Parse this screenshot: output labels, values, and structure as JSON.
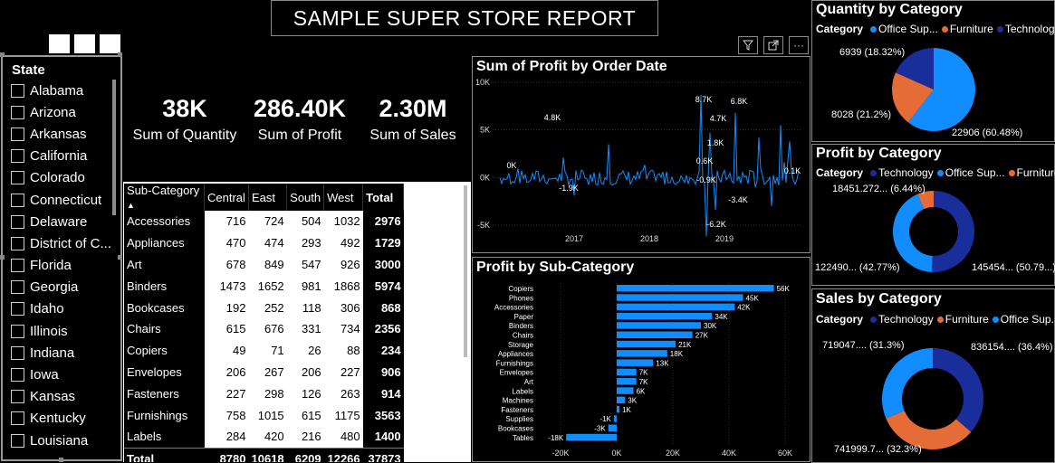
{
  "header": {
    "title": "SAMPLE SUPER STORE REPORT"
  },
  "slicer": {
    "title": "State",
    "items": [
      "Alabama",
      "Arizona",
      "Arkansas",
      "California",
      "Colorado",
      "Connecticut",
      "Delaware",
      "District of C...",
      "Florida",
      "Georgia",
      "Idaho",
      "Illinois",
      "Indiana",
      "Iowa",
      "Kansas",
      "Kentucky",
      "Louisiana"
    ]
  },
  "kpis": [
    {
      "value": "38K",
      "label": "Sum of Quantity"
    },
    {
      "value": "286.40K",
      "label": "Sum of Profit"
    },
    {
      "value": "2.30M",
      "label": "Sum of Sales"
    }
  ],
  "matrix": {
    "columns": [
      "Sub-Category",
      "Central",
      "East",
      "South",
      "West",
      "Total"
    ],
    "sort_indicator": "▲",
    "rows": [
      [
        "Accessories",
        "716",
        "724",
        "504",
        "1032",
        "2976"
      ],
      [
        "Appliances",
        "470",
        "474",
        "293",
        "492",
        "1729"
      ],
      [
        "Art",
        "678",
        "849",
        "547",
        "926",
        "3000"
      ],
      [
        "Binders",
        "1473",
        "1652",
        "981",
        "1868",
        "5974"
      ],
      [
        "Bookcases",
        "192",
        "252",
        "118",
        "306",
        "868"
      ],
      [
        "Chairs",
        "615",
        "676",
        "331",
        "734",
        "2356"
      ],
      [
        "Copiers",
        "49",
        "71",
        "26",
        "88",
        "234"
      ],
      [
        "Envelopes",
        "206",
        "267",
        "206",
        "227",
        "906"
      ],
      [
        "Fasteners",
        "227",
        "298",
        "126",
        "263",
        "914"
      ],
      [
        "Furnishings",
        "758",
        "1015",
        "615",
        "1175",
        "3563"
      ],
      [
        "Labels",
        "284",
        "420",
        "216",
        "480",
        "1400"
      ]
    ],
    "total": [
      "Total",
      "8780",
      "10618",
      "6209",
      "12266",
      "37873"
    ]
  },
  "visual_toolbar": {
    "icons": [
      "filter-icon",
      "focus-mode-icon",
      "more-options-icon"
    ],
    "more_label": "···"
  },
  "profit_by_date": {
    "title": "Sum of Profit by Order Date",
    "y_ticks": [
      "10K",
      "5K",
      "0K",
      "-5K"
    ],
    "x_ticks": [
      "2017",
      "2018",
      "2019"
    ],
    "annotations": [
      "4.8K",
      "-1.9K",
      "0K",
      "8.7K",
      "6.8K",
      "4.7K",
      "1.8K",
      "0.6K",
      "-0.9K",
      "-3.4K",
      "-6.2K",
      "0.1K"
    ]
  },
  "profit_by_subcategory": {
    "title": "Profit by Sub-Category",
    "x_ticks": [
      "-20K",
      "0K",
      "20K",
      "40K",
      "60K"
    ],
    "bars": [
      {
        "name": "Copiers",
        "label": "56K",
        "value": 56
      },
      {
        "name": "Phones",
        "label": "45K",
        "value": 45
      },
      {
        "name": "Accessories",
        "label": "42K",
        "value": 42
      },
      {
        "name": "Paper",
        "label": "34K",
        "value": 34
      },
      {
        "name": "Binders",
        "label": "30K",
        "value": 30
      },
      {
        "name": "Chairs",
        "label": "27K",
        "value": 27
      },
      {
        "name": "Storage",
        "label": "21K",
        "value": 21
      },
      {
        "name": "Appliances",
        "label": "18K",
        "value": 18
      },
      {
        "name": "Furnishings",
        "label": "13K",
        "value": 13
      },
      {
        "name": "Envelopes",
        "label": "7K",
        "value": 7
      },
      {
        "name": "Art",
        "label": "7K",
        "value": 7
      },
      {
        "name": "Labels",
        "label": "6K",
        "value": 6
      },
      {
        "name": "Machines",
        "label": "3K",
        "value": 3
      },
      {
        "name": "Fasteners",
        "label": "1K",
        "value": 1
      },
      {
        "name": "Supplies",
        "label": "-1K",
        "value": -1
      },
      {
        "name": "Bookcases",
        "label": "-3K",
        "value": -3
      },
      {
        "name": "Tables",
        "label": "-18K",
        "value": -18
      }
    ]
  },
  "quantity_by_category": {
    "title": "Quantity by Category",
    "legend_title": "Category",
    "legend": [
      "Office Sup...",
      "Furniture",
      "Technology"
    ],
    "labels": [
      "6939 (18.32%)",
      "8028 (21.2%)",
      "22906 (60.48%)"
    ]
  },
  "profit_by_category": {
    "title": "Profit by Category",
    "legend_title": "Category",
    "legend": [
      "Technology",
      "Office Sup...",
      "Furniture"
    ],
    "labels": [
      "18451.272... (6.44%)",
      "122490... (42.77%)",
      "145454... (50.79...)"
    ]
  },
  "sales_by_category": {
    "title": "Sales by Category",
    "legend_title": "Category",
    "legend": [
      "Technology",
      "Furniture",
      "Office Sup..."
    ],
    "labels": [
      "719047.... (31.3%)",
      "836154.... (36.4%)",
      "741999.7... (32.3%)"
    ]
  },
  "colors": {
    "technology": "#1a2e9b",
    "furniture": "#e66c37",
    "office_supplies": "#118dff",
    "bar": "#118dff"
  },
  "chart_data": [
    {
      "type": "line",
      "title": "Sum of Profit by Order Date",
      "xlabel": "",
      "ylabel": "",
      "x_ticks": [
        "2017",
        "2018",
        "2019"
      ],
      "ylim": [
        -5000,
        10000
      ],
      "y_ticks": [
        10000,
        5000,
        0,
        -5000
      ],
      "annotations": [
        {
          "x": "2016-03",
          "y": 4800,
          "label": "4.8K"
        },
        {
          "x": "2016-06",
          "y": -1900,
          "label": "-1.9K"
        },
        {
          "x": "2015-01",
          "y": 0,
          "label": "0K"
        },
        {
          "x": "2018-10",
          "y": 8700,
          "label": "8.7K"
        },
        {
          "x": "2019-02",
          "y": 6800,
          "label": "6.8K"
        },
        {
          "x": "2019-01",
          "y": 4700,
          "label": "4.7K"
        },
        {
          "x": "2018-12",
          "y": 1800,
          "label": "1.8K"
        },
        {
          "x": "2018-12",
          "y": 600,
          "label": "0.6K"
        },
        {
          "x": "2018-11",
          "y": -900,
          "label": "-0.9K"
        },
        {
          "x": "2019-03",
          "y": -3400,
          "label": "-3.4K"
        },
        {
          "x": "2018-12",
          "y": -6200,
          "label": "-6.2K"
        },
        {
          "x": "2019-12",
          "y": 100,
          "label": "0.1K"
        }
      ]
    },
    {
      "type": "bar",
      "title": "Profit by Sub-Category",
      "categories": [
        "Copiers",
        "Phones",
        "Accessories",
        "Paper",
        "Binders",
        "Chairs",
        "Storage",
        "Appliances",
        "Furnishings",
        "Envelopes",
        "Art",
        "Labels",
        "Machines",
        "Fasteners",
        "Supplies",
        "Bookcases",
        "Tables"
      ],
      "values": [
        56000,
        45000,
        42000,
        34000,
        30000,
        27000,
        21000,
        18000,
        13000,
        7000,
        7000,
        6000,
        3000,
        1000,
        -1000,
        -3000,
        -18000
      ],
      "xlim": [
        -20000,
        60000
      ]
    },
    {
      "type": "pie",
      "title": "Quantity by Category",
      "categories": [
        "Office Supplies",
        "Furniture",
        "Technology"
      ],
      "values": [
        22906,
        8028,
        6939
      ]
    },
    {
      "type": "pie",
      "title": "Profit by Category",
      "categories": [
        "Technology",
        "Office Supplies",
        "Furniture"
      ],
      "values": [
        145454,
        122490,
        18451.272
      ]
    },
    {
      "type": "pie",
      "title": "Sales by Category",
      "categories": [
        "Technology",
        "Furniture",
        "Office Supplies"
      ],
      "values": [
        836154,
        741999.7,
        719047
      ]
    }
  ]
}
